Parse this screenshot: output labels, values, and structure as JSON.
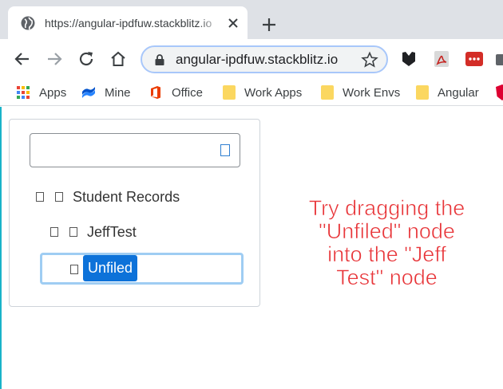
{
  "browser": {
    "tab": {
      "title": "https://angular-ipdfuw.stackblitz.io",
      "favicon": "globe-icon"
    },
    "address_bar": {
      "url": "angular-ipdfuw.stackblitz.io"
    },
    "bookmarks": [
      {
        "label": "Apps",
        "icon": "apps-grid-icon"
      },
      {
        "label": "Mine",
        "icon": "confluence-icon"
      },
      {
        "label": "Office",
        "icon": "office-icon"
      },
      {
        "label": "Work Apps",
        "icon": "folder-icon"
      },
      {
        "label": "Work Envs",
        "icon": "folder-icon"
      },
      {
        "label": "Angular",
        "icon": "folder-icon"
      }
    ],
    "colors": {
      "tabstrip": "#dee1e6",
      "omnibox_border": "#a8c7fa"
    }
  },
  "tree": {
    "filter": {
      "value": "",
      "icon": "filter-icon"
    },
    "nodes": [
      {
        "label": "Student Records",
        "level": 0
      },
      {
        "label": "JeffTest",
        "level": 1
      },
      {
        "label": "Unfiled",
        "level": 2,
        "selected": true
      }
    ],
    "colors": {
      "selected_bg": "#0d72d9",
      "drop_outline": "#9fcdf3"
    }
  },
  "annotation": {
    "lines": [
      "Try dragging the",
      "\"Unfiled\" node",
      "into the \"Jeff",
      "Test\" node"
    ],
    "color": "#e8363a"
  }
}
